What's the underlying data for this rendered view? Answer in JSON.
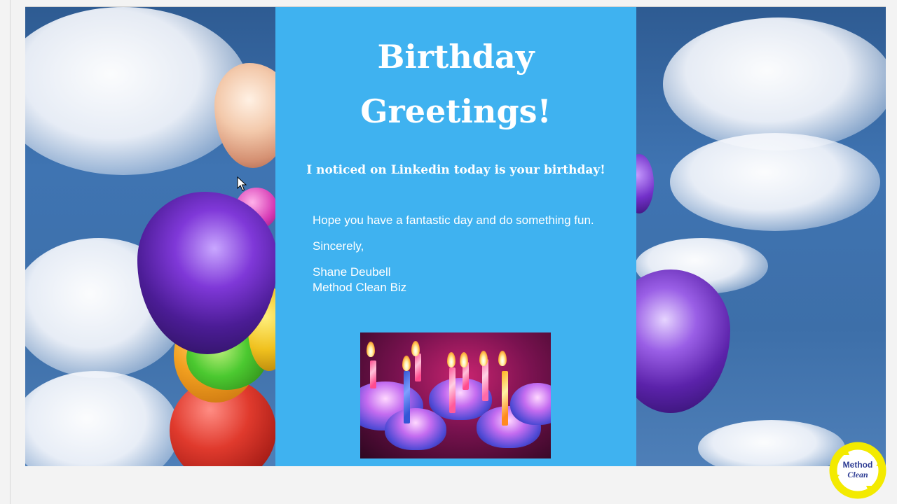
{
  "card": {
    "title_line1": "Birthday",
    "title_line2": "Greetings!",
    "subtitle": "I noticed on Linkedin today is your birthday!",
    "body_line1": "Hope you have a fantastic day and do something fun.",
    "closing": "Sincerely,",
    "sender_name": "Shane Deubell",
    "sender_company": "Method Clean Biz",
    "background_color": "#3fb2f0",
    "text_color": "#ffffff"
  },
  "watermark": {
    "brand": "Method",
    "sub": "Clean",
    "ring_color": "#f3ea00",
    "text_color": "#2d3c93"
  },
  "icons": [
    "mouse-cursor-icon"
  ]
}
